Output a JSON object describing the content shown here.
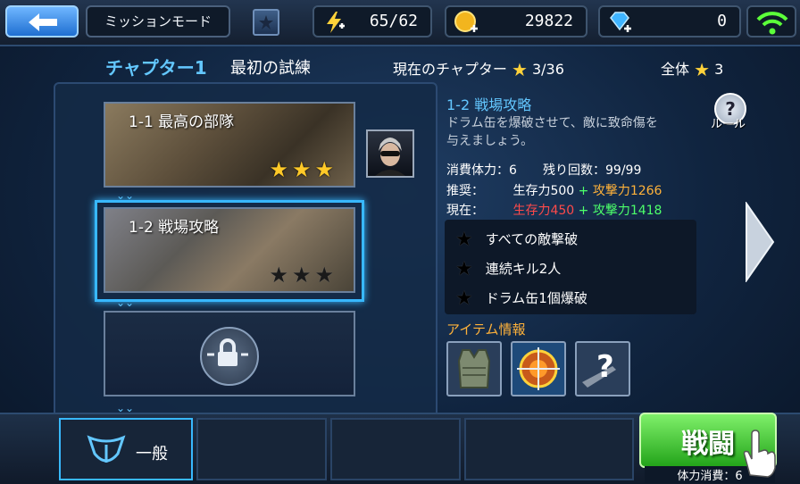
{
  "topbar": {
    "mode_label": "ミッションモード",
    "stamina": "65/62",
    "gold": "29822",
    "gems": "0"
  },
  "header": {
    "chapter_title": "チャプター1",
    "chapter_subtitle": "最初の試練",
    "current_chapter_label": "現在のチャプター",
    "current_chapter_value": "3/36",
    "total_label": "全体",
    "total_value": "3"
  },
  "missions": [
    {
      "title": "1-1 最高の部隊",
      "stars_earned": 3
    },
    {
      "title": "1-2 戦場攻略",
      "stars_earned": 0
    },
    {
      "title": "",
      "locked": true
    }
  ],
  "detail": {
    "title": "1-2 戦場攻略",
    "description": "ドラム缶を爆破させて、敵に致命傷を与えましょう。",
    "stamina_cost_label": "消費体力：6",
    "remaining_label": "残り回数：99/99",
    "recommended_label": "推奨：",
    "recommended_survival": "生存力500",
    "recommended_attack": "攻撃力1266",
    "current_label": "現在：",
    "current_survival": "生存力450",
    "current_attack": "攻撃力1418",
    "plus": "+",
    "objectives": [
      "すべての敵撃破",
      "連続キル2人",
      "ドラム缶1個爆破"
    ],
    "item_info_label": "アイテム情報",
    "rule_label": "ルール",
    "rule_symbol": "?"
  },
  "bottom": {
    "tab_label": "一般",
    "fight_label": "戦闘",
    "fight_cost": "体力消費：6"
  },
  "colors": {
    "accent_blue": "#63c7ff",
    "gold_star": "#ffc928",
    "survival_red": "#ff4a4a",
    "attack_orange": "#ffb23a",
    "attack_green": "#4cff6a",
    "plus_green": "#4cff6a",
    "fight_green": "#23a41a"
  }
}
